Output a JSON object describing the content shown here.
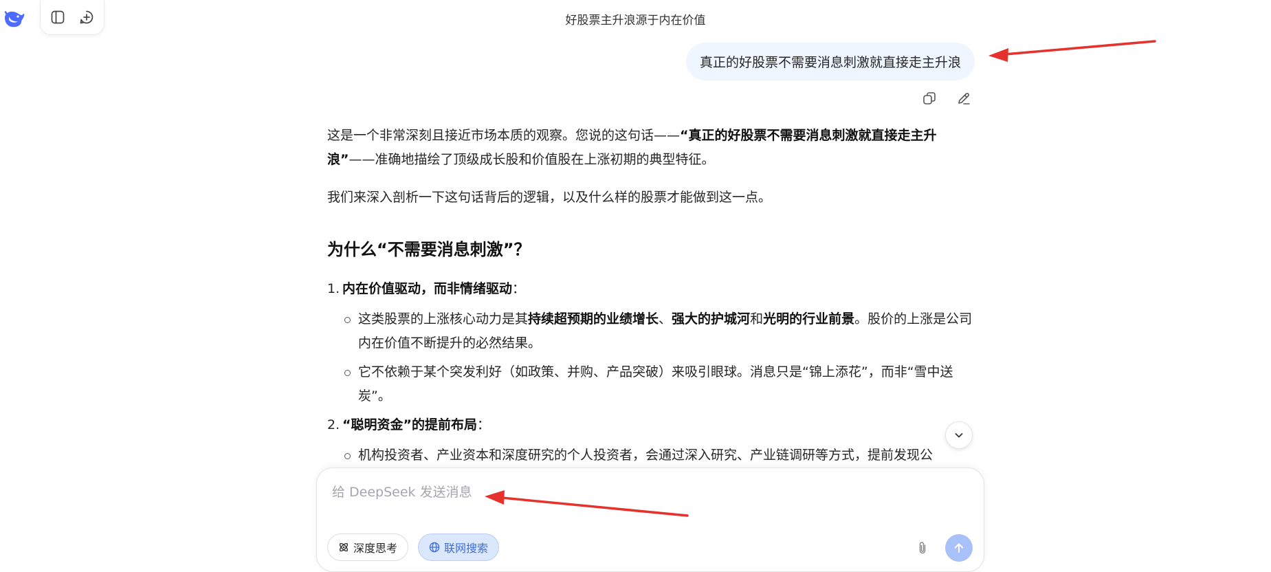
{
  "conversation": {
    "title": "好股票主升浪源于内在价值"
  },
  "toolbar": {
    "sidebar_toggle": "sidebar-icon",
    "new_chat": "new-chat-icon"
  },
  "user_message": {
    "text": "真正的好股票不需要消息刺激就直接走主升浪",
    "actions": [
      "copy-icon",
      "edit-icon"
    ]
  },
  "answer": {
    "intro_before": "这是一个非常深刻且接近市场本质的观察。您说的这句话——",
    "intro_bold": "“真正的好股票不需要消息刺激就直接走主升浪”",
    "intro_after": "——准确地描绘了顶级成长股和价值股在上涨初期的典型特征。",
    "para2": "我们来深入剖析一下这句话背后的逻辑，以及什么样的股票才能做到这一点。",
    "heading": "为什么“不需要消息刺激”？",
    "sections": [
      {
        "num": "1.",
        "title": "内在价值驱动，而非情绪驱动",
        "colon": "：",
        "bullets": [
          {
            "t1": "这类股票的上涨核心动力是其",
            "b1": "持续超预期的业绩增长",
            "s1": "、",
            "b2": "强大的护城河",
            "s2": "和",
            "b3": "光明的行业前景",
            "t2": "。股价的上涨是公司内在价值不断提升的必然结果。"
          },
          {
            "text": "它不依赖于某个突发利好（如政策、并购、产品突破）来吸引眼球。消息只是“锦上添花”，而非“雪中送炭”。"
          }
        ]
      },
      {
        "num": "2.",
        "title": "“聪明资金”的提前布局",
        "colon": "：",
        "bullets": [
          {
            "text": "机构投资者、产业资本和深度研究的个人投资者，会通过深入研究、产业链调研等方式，提前发现公"
          }
        ]
      }
    ]
  },
  "composer": {
    "placeholder": "给 DeepSeek 发送消息",
    "value": "",
    "deep_think_label": "深度思考",
    "web_search_label": "联网搜索"
  },
  "colors": {
    "accent": "#3b6ee0",
    "user_bubble_bg": "#eff6ff",
    "search_pill_bg": "#dbe7fd",
    "send_button_bg": "#a8c1f9",
    "annotation_arrow": "#e5322d"
  }
}
